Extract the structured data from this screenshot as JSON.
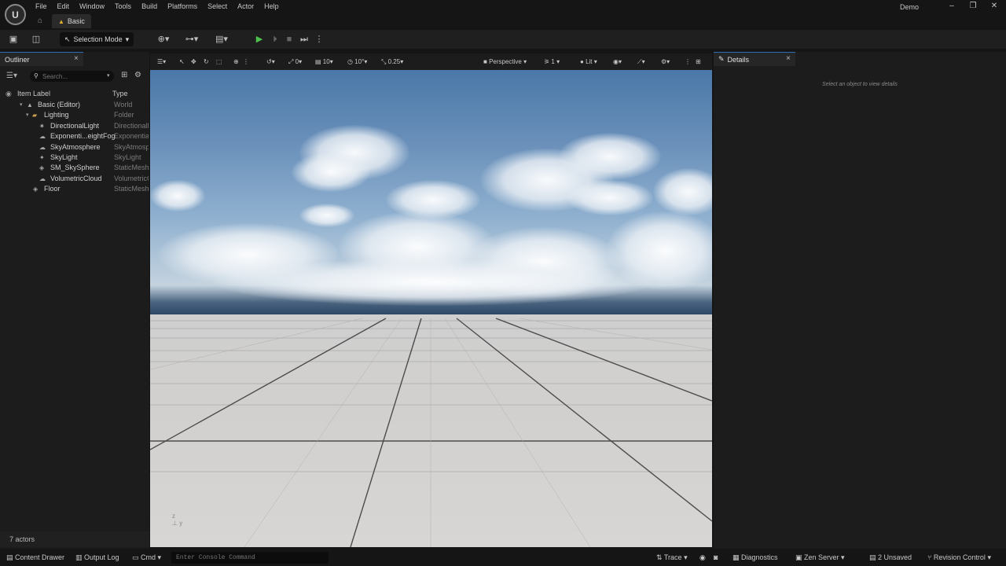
{
  "menu": {
    "items": [
      "File",
      "Edit",
      "Window",
      "Tools",
      "Build",
      "Platforms",
      "Select",
      "Actor",
      "Help"
    ]
  },
  "window": {
    "title": "Demo",
    "minimize": "–",
    "restore": "❐",
    "close": "✕"
  },
  "level_tab": {
    "label": "Basic"
  },
  "toolbar": {
    "selection_mode": "Selection Mode"
  },
  "outliner": {
    "tab_label": "Outliner",
    "search_placeholder": "Search...",
    "columns": {
      "label": "Item Label",
      "type": "Type"
    },
    "items": [
      {
        "label": "Basic (Editor)",
        "type": "World"
      },
      {
        "label": "Lighting",
        "type": "Folder"
      },
      {
        "label": "DirectionalLight",
        "type": "DirectionalLight"
      },
      {
        "label": "Exponenti...eightFog",
        "type": "ExponentialHeightFog"
      },
      {
        "label": "SkyAtmosphere",
        "type": "SkyAtmosphere"
      },
      {
        "label": "SkyLight",
        "type": "SkyLight"
      },
      {
        "label": "SM_SkySphere",
        "type": "StaticMeshActor"
      },
      {
        "label": "VolumetricCloud",
        "type": "VolumetricCloud"
      },
      {
        "label": "Floor",
        "type": "StaticMeshActor"
      }
    ],
    "actor_count": "7 actors"
  },
  "viewport": {
    "translate_snap": "0",
    "grid_snap": "10",
    "rotate_snap": "10°",
    "scale_snap": "0.25",
    "view_mode": "Perspective",
    "layout_count": "1",
    "lighting_mode": "Lit"
  },
  "details": {
    "tab_label": "Details",
    "empty_message": "Select an object to view details"
  },
  "statusbar": {
    "content_drawer": "Content Drawer",
    "output_log": "Output Log",
    "cmd": "Cmd",
    "console_placeholder": "Enter Console Command",
    "trace": "Trace",
    "diagnostics": "Diagnostics",
    "zen_server": "Zen Server",
    "unsaved": "2 Unsaved",
    "revision_control": "Revision Control"
  },
  "colors": {
    "accent_blue": "#2d6fb5",
    "play_green": "#4cc34c",
    "folder": "#c8a050"
  }
}
